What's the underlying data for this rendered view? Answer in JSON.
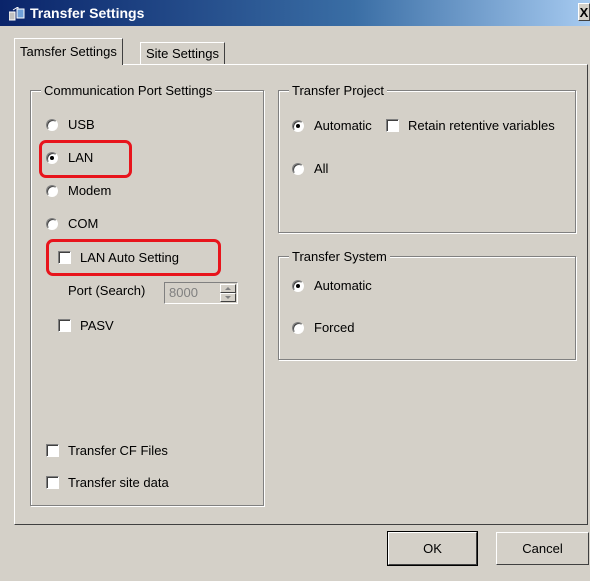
{
  "window": {
    "title": "Transfer Settings",
    "close_symbol": "X",
    "icon": "transfer-icon"
  },
  "tabs": [
    {
      "label": "Tamsfer Settings",
      "active": true
    },
    {
      "label": "Site Settings",
      "active": false
    }
  ],
  "comm_port": {
    "title": "Communication Port Settings",
    "options": [
      {
        "label": "USB",
        "checked": false
      },
      {
        "label": "LAN",
        "checked": true
      },
      {
        "label": "Modem",
        "checked": false
      },
      {
        "label": "COM",
        "checked": false
      }
    ],
    "lan_auto": {
      "label": "LAN Auto Setting",
      "checked": false
    },
    "port_search": {
      "label": "Port (Search)",
      "value": "8000"
    },
    "pasv": {
      "label": "PASV",
      "checked": false
    },
    "transfer_cf": {
      "label": "Transfer CF Files",
      "checked": false
    },
    "transfer_site": {
      "label": "Transfer site data",
      "checked": false
    }
  },
  "transfer_project": {
    "title": "Transfer Project",
    "automatic": {
      "label": "Automatic",
      "checked": true
    },
    "retain": {
      "label": "Retain retentive variables",
      "checked": false
    },
    "all": {
      "label": "All",
      "checked": false
    }
  },
  "transfer_system": {
    "title": "Transfer System",
    "automatic": {
      "label": "Automatic",
      "checked": true
    },
    "forced": {
      "label": "Forced",
      "checked": false
    }
  },
  "buttons": {
    "ok": "OK",
    "cancel": "Cancel"
  },
  "colors": {
    "highlight": "#e8141c",
    "dialog_bg": "#d4d0c8",
    "title_bar": "#0a246a"
  }
}
